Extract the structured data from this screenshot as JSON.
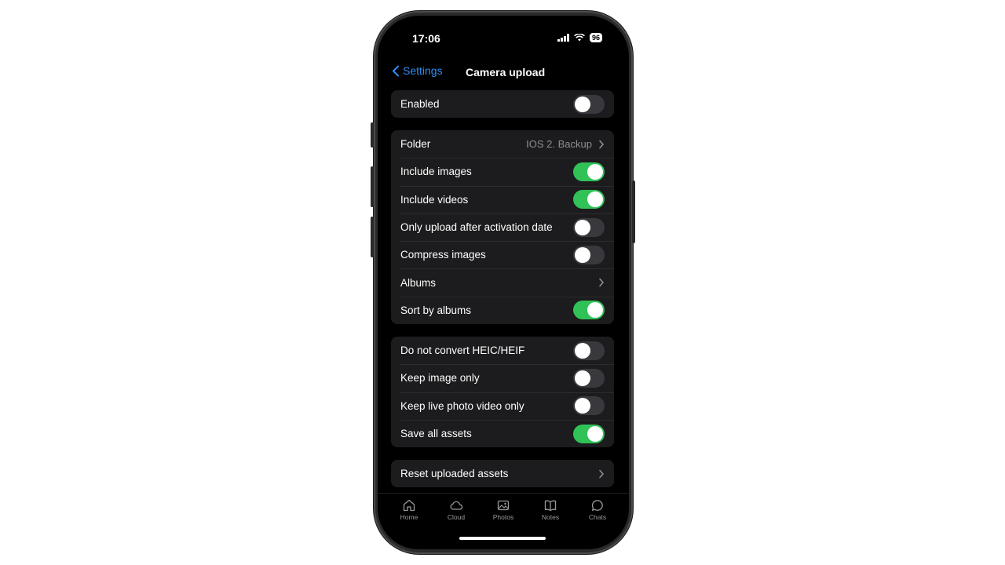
{
  "status": {
    "time": "17:06",
    "battery": "96"
  },
  "nav": {
    "back_label": "Settings",
    "title": "Camera upload"
  },
  "groups": [
    {
      "rows": [
        {
          "label": "Enabled",
          "toggle": false
        }
      ]
    },
    {
      "rows": [
        {
          "label": "Folder",
          "value": "IOS 2. Backup"
        },
        {
          "label": "Include images",
          "toggle": true
        },
        {
          "label": "Include videos",
          "toggle": true
        },
        {
          "label": "Only upload after activation date",
          "toggle": false
        },
        {
          "label": "Compress images",
          "toggle": false
        },
        {
          "label": "Albums"
        },
        {
          "label": "Sort by albums",
          "toggle": true
        }
      ]
    },
    {
      "rows": [
        {
          "label": "Do not convert HEIC/HEIF",
          "toggle": false
        },
        {
          "label": "Keep image only",
          "toggle": false
        },
        {
          "label": "Keep live photo video only",
          "toggle": false
        },
        {
          "label": "Save all assets",
          "toggle": true
        }
      ]
    },
    {
      "rows": [
        {
          "label": "Reset uploaded assets"
        }
      ]
    }
  ],
  "tabs": [
    {
      "label": "Home",
      "icon": "home-icon"
    },
    {
      "label": "Cloud",
      "icon": "cloud-icon"
    },
    {
      "label": "Photos",
      "icon": "photos-icon"
    },
    {
      "label": "Notes",
      "icon": "notes-icon"
    },
    {
      "label": "Chats",
      "icon": "chats-icon"
    }
  ],
  "colors": {
    "accent": "#2f8df5",
    "toggle_on": "#30c257",
    "toggle_off": "#39393d"
  }
}
